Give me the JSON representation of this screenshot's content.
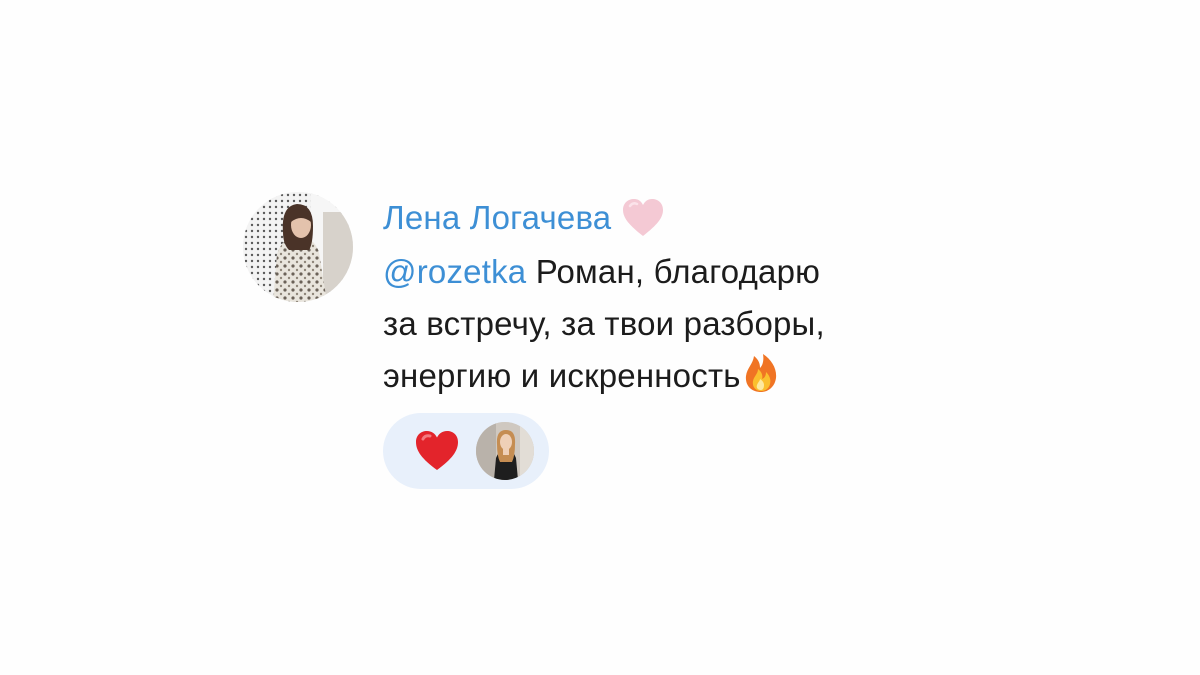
{
  "message": {
    "author": "Лена Логачева",
    "author_badge_icon": "pink-heart-icon",
    "mention": "@rozetka",
    "text_line1": " Роман, благодарю",
    "text_line2": "за встречу, за твои разборы,",
    "text_line3": "энергию и искренность",
    "trailing_emoji": "fire-icon"
  },
  "reaction": {
    "emoji": "red-heart-icon",
    "reactor_avatar": "avatar"
  },
  "colors": {
    "link_blue": "#3d8fd5",
    "reaction_bg": "#e8f0fb",
    "text": "#1c1c1c"
  }
}
